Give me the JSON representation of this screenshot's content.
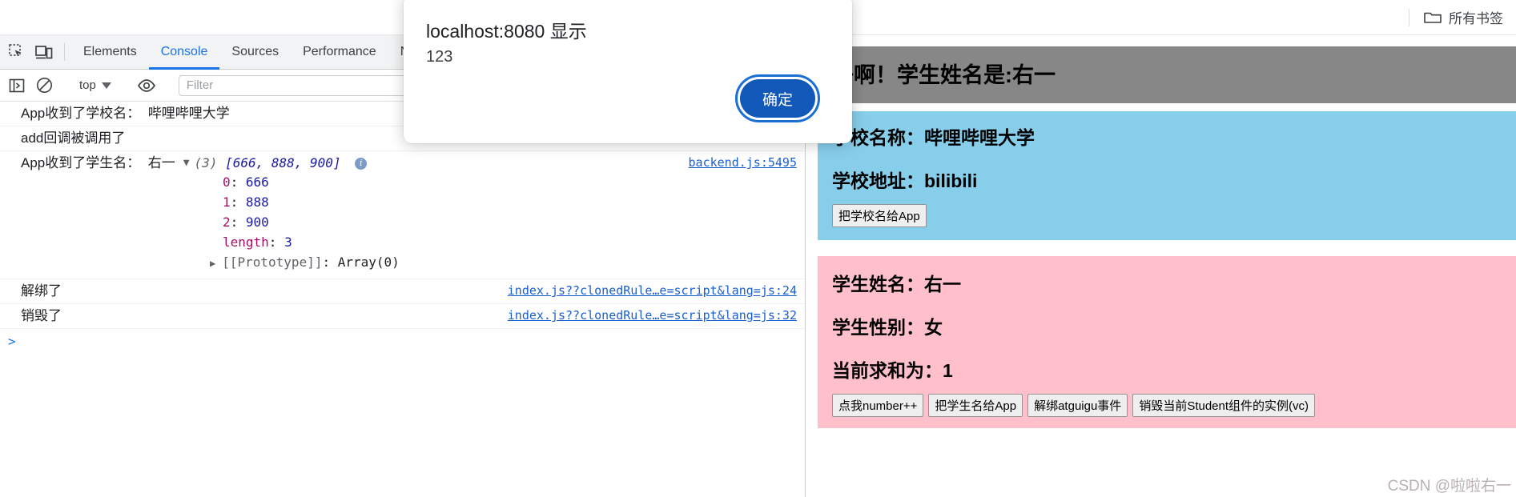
{
  "bookmark_bar": {
    "folder_icon": "folder-icon",
    "label": "所有书签"
  },
  "devtools": {
    "inspect_icon": "inspect-element-icon",
    "device_icon": "device-toolbar-icon",
    "tabs": [
      {
        "label": "Elements",
        "active": false
      },
      {
        "label": "Console",
        "active": true
      },
      {
        "label": "Sources",
        "active": false
      },
      {
        "label": "Performance",
        "active": false
      },
      {
        "label": "N",
        "active": false
      }
    ],
    "toolbar": {
      "clear_icon": "clear-console-icon",
      "sidebar_icon": "console-sidebar-icon",
      "context": "top",
      "context_caret": "chevron-down-icon",
      "eye_icon": "live-expression-eye-icon",
      "filter_placeholder": "Filter",
      "filter_value": ""
    },
    "console": {
      "rows": [
        {
          "message": "App收到了学校名：  哔哩哔哩大学",
          "source": ""
        },
        {
          "message": "add回调被调用了",
          "source": ""
        },
        {
          "message": "App收到了学生名：  右一",
          "source": "backend.js:5495"
        },
        {
          "message": "解绑了",
          "source": "index.js??clonedRule…e=script&lang=js:24"
        },
        {
          "message": "销毁了",
          "source": "index.js??clonedRule…e=script&lang=js:32"
        }
      ],
      "array": {
        "triangle": "▼",
        "count": "(3)",
        "preview": "[666, 888, 900]",
        "info_badge": "i",
        "entries": [
          {
            "key": "0",
            "value": "666"
          },
          {
            "key": "1",
            "value": "888"
          },
          {
            "key": "2",
            "value": "900"
          }
        ],
        "length_key": "length",
        "length_value": "3",
        "proto_triangle": "▶",
        "proto_key": "[[Prototype]]",
        "proto_value": "Array(0)"
      },
      "prompt_caret": ">"
    }
  },
  "dialog": {
    "title": "localhost:8080 显示",
    "message": "123",
    "ok_label": "确定"
  },
  "app": {
    "header": {
      "text": "子啊！学生姓名是:右一",
      "bg_color": "#878787"
    },
    "school": {
      "bg_color": "#87ceeb",
      "name_line": "学校名称：哔哩哔哩大学",
      "address_line": "学校地址：bilibili",
      "button": "把学校名给App"
    },
    "student": {
      "bg_color": "#ffc0cb",
      "name_line": "学生姓名：右一",
      "gender_line": "学生性别：女",
      "sum_line": "当前求和为：1",
      "buttons": [
        "点我number++",
        "把学生名给App",
        "解绑atguigu事件",
        "销毁当前Student组件的实例(vc)"
      ]
    },
    "watermark": "CSDN @啦啦右一"
  }
}
